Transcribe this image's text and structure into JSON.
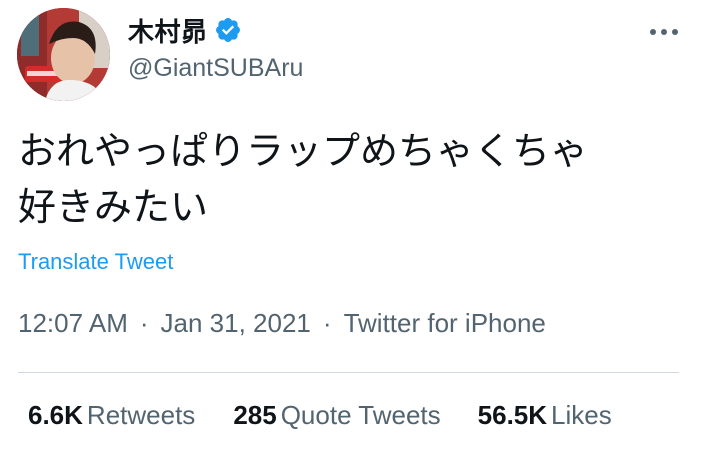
{
  "author": {
    "display_name": "木村昴",
    "handle": "@GiantSUBAru",
    "verified": true,
    "avatar_icon": "profile-photo",
    "verified_icon": "verified-badge-icon"
  },
  "menu": {
    "more_icon": "more-options-icon"
  },
  "tweet": {
    "text": "おれやっぱりラップめちゃくちゃ\n好きみたい",
    "translate_label": "Translate Tweet"
  },
  "meta": {
    "time": "12:07 AM",
    "separator": "·",
    "date": "Jan 31, 2021",
    "source": "Twitter for iPhone"
  },
  "stats": {
    "retweets": {
      "count": "6.6K",
      "label": "Retweets"
    },
    "quote_tweets": {
      "count": "285",
      "label": "Quote Tweets"
    },
    "likes": {
      "count": "56.5K",
      "label": "Likes"
    }
  },
  "colors": {
    "link": "#1d9bf0",
    "secondary_text": "#536471",
    "primary_text": "#0f1419",
    "divider": "#cfd9de"
  }
}
